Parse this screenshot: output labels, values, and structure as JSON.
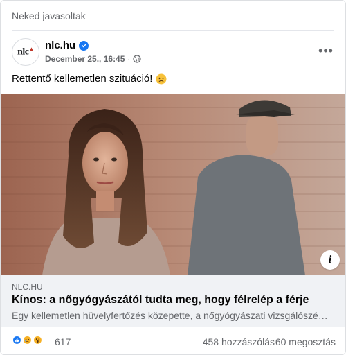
{
  "section": {
    "header": "Neked javasoltak"
  },
  "post": {
    "author": "nlc.hu",
    "avatar_text": "nlc",
    "verified": true,
    "timestamp": "December 25., 16:45",
    "separator": "·",
    "audience_icon": "globe-icon",
    "more_icon": "•••",
    "text": "Rettentő kellemetlen szituáció!",
    "text_emoji": "disappointed-face"
  },
  "link": {
    "image_description_icon": "info-icon",
    "info_glyph": "i",
    "domain": "NLC.HU",
    "title": "Kínos: a nőgyógyászától tudta meg, hogy félrelép a férje",
    "description": "Egy kellemetlen hüvelyfertőzés közepette, a nőgyógyászati vizsgálószé…"
  },
  "engagement": {
    "reactions": [
      "like",
      "sad",
      "wow"
    ],
    "reaction_count": "617",
    "comments": "458 hozzászólás",
    "shares": "60 megosztás"
  },
  "colors": {
    "accent": "#1877f2",
    "secondary_text": "#65676b",
    "link_box_bg": "#f0f2f5"
  }
}
